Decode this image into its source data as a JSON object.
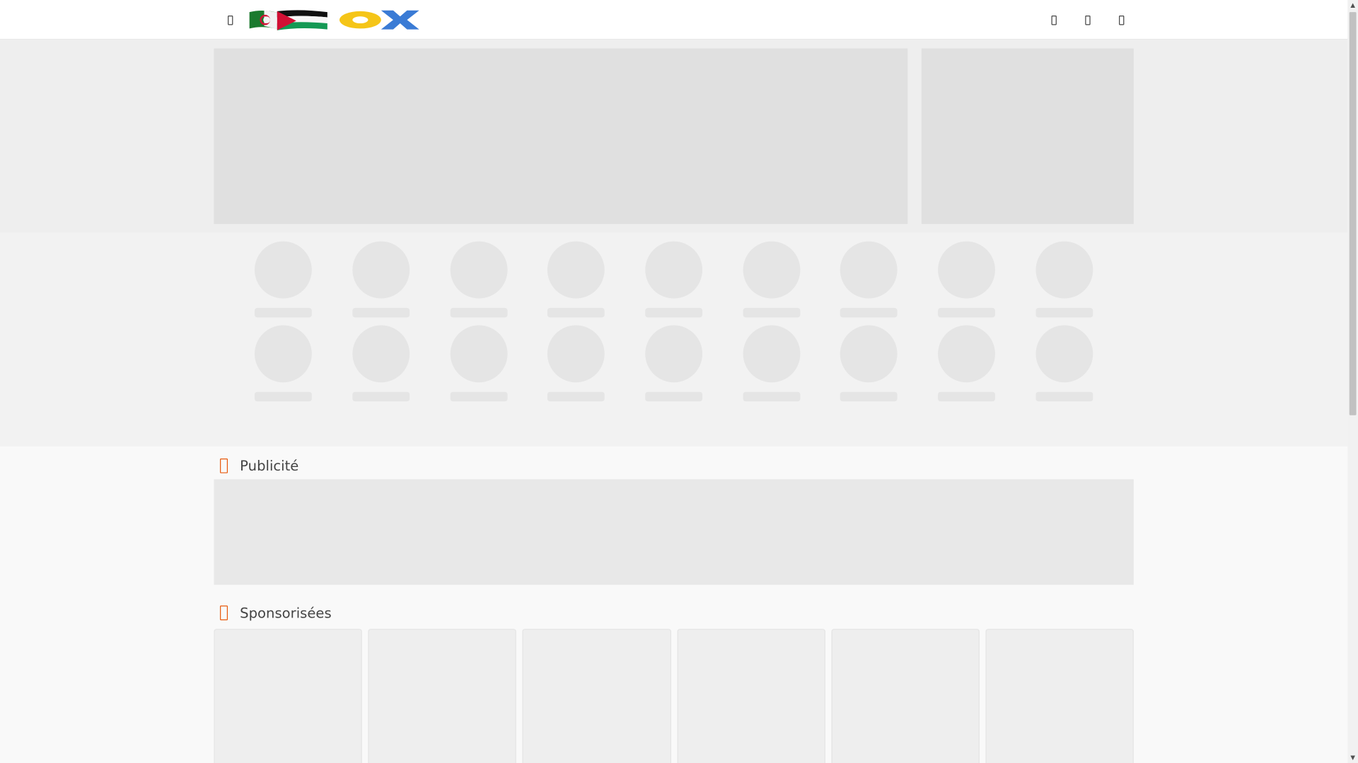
{
  "header": {
    "logo_alt": "OOX",
    "icons": [
      "menu-icon",
      "search-icon",
      "notification-icon",
      "account-icon"
    ]
  },
  "sections": {
    "ad_title": "Publicité",
    "sponsored_title": "Sponsorisées"
  },
  "colors": {
    "accent": "#e8590c",
    "skeleton": "#e0e0e0",
    "logo_yellow": "#f5c518",
    "logo_blue": "#3a7bd5"
  },
  "categories": [
    {
      "label": ""
    },
    {
      "label": ""
    },
    {
      "label": ""
    },
    {
      "label": ""
    },
    {
      "label": ""
    },
    {
      "label": ""
    },
    {
      "label": ""
    },
    {
      "label": ""
    },
    {
      "label": ""
    },
    {
      "label": ""
    },
    {
      "label": ""
    },
    {
      "label": ""
    },
    {
      "label": ""
    },
    {
      "label": ""
    },
    {
      "label": ""
    },
    {
      "label": ""
    },
    {
      "label": ""
    },
    {
      "label": ""
    }
  ],
  "sponsored": [
    {},
    {},
    {},
    {},
    {},
    {}
  ]
}
